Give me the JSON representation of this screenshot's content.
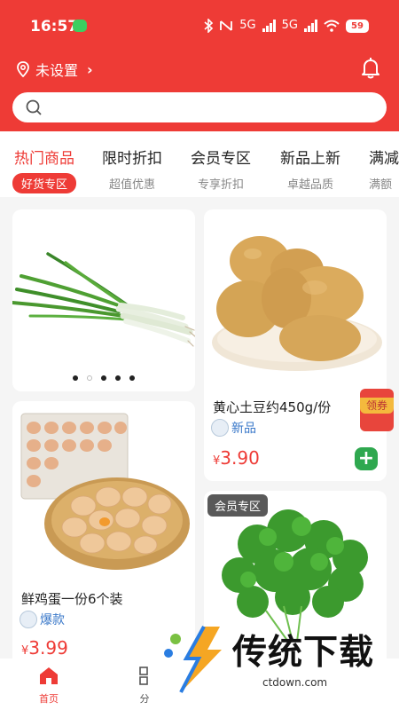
{
  "status": {
    "time": "16:57",
    "net1": "5G",
    "net2": "5G",
    "battery": "59"
  },
  "location": {
    "label": "未设置"
  },
  "colors": {
    "brand": "#ee3b36",
    "add": "#2fa84f",
    "tagBlue": "#3a78c9"
  },
  "tabs": [
    {
      "title": "热门商品",
      "sub": "好货专区",
      "active": true
    },
    {
      "title": "限时折扣",
      "sub": "超值优惠"
    },
    {
      "title": "会员专区",
      "sub": "专享折扣"
    },
    {
      "title": "新品上新",
      "sub": "卓越品质"
    },
    {
      "title": "满减",
      "sub": "满额"
    }
  ],
  "products": {
    "banner": {
      "image": "green-onion"
    },
    "potato": {
      "name": "黄心土豆约450g/份",
      "tag": "新品",
      "currency": "¥",
      "price": "3.90",
      "image": "potato"
    },
    "eggs": {
      "name": "鲜鸡蛋一份6个装",
      "tag": "爆款",
      "currency": "¥",
      "price": "3.99",
      "image": "eggs"
    },
    "coriander": {
      "badge": "会员专区",
      "image": "coriander"
    }
  },
  "coupon": {
    "label": "领券"
  },
  "nav": [
    {
      "label": "首页",
      "active": true
    },
    {
      "label": "分"
    }
  ],
  "watermark": {
    "title": "传统下载",
    "site": "ctdown.com"
  }
}
